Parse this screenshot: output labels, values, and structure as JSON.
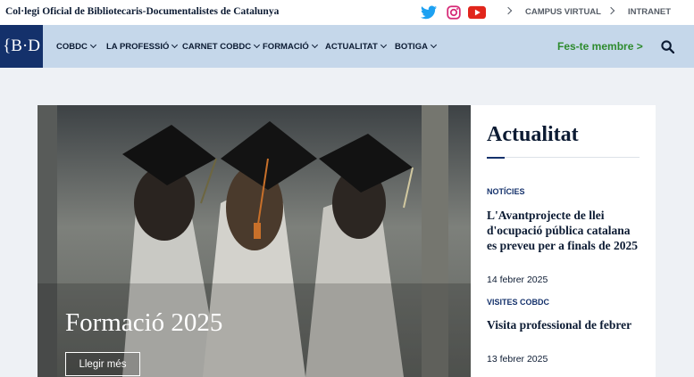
{
  "header": {
    "org_name": "Col·legi Oficial de Bibliotecaris-Documentalistes de Catalunya",
    "social": [
      "twitter-icon",
      "instagram-icon",
      "youtube-icon"
    ],
    "links": [
      {
        "label": "CAMPUS VIRTUAL"
      },
      {
        "label": "INTRANET"
      }
    ]
  },
  "nav": {
    "logo_text": "{B·D",
    "items": [
      {
        "label": "COBDC"
      },
      {
        "label": "LA PROFESSIÓ"
      },
      {
        "label": "CARNET COBDC"
      },
      {
        "label": "FORMACIÓ"
      },
      {
        "label": "ACTUALITAT"
      },
      {
        "label": "BOTIGA"
      }
    ],
    "join_label": "Fes-te membre >"
  },
  "hero": {
    "title": "Formació 2025",
    "button_label": "Llegir més"
  },
  "news": {
    "heading": "Actualitat",
    "items": [
      {
        "category": "NOTÍCIES",
        "headline": "L'Avantprojecte de llei d'ocupació pública catalana es preveu per a finals de 2025",
        "date": "14 febrer 2025"
      },
      {
        "category": "VISITES COBDC",
        "headline": "Visita professional de febrer",
        "date": "13 febrer 2025"
      }
    ]
  },
  "colors": {
    "navy": "#14316b",
    "nav_bg": "#c5d7ea",
    "join_green": "#2e8b2e",
    "page_bg": "#eef1f5"
  }
}
